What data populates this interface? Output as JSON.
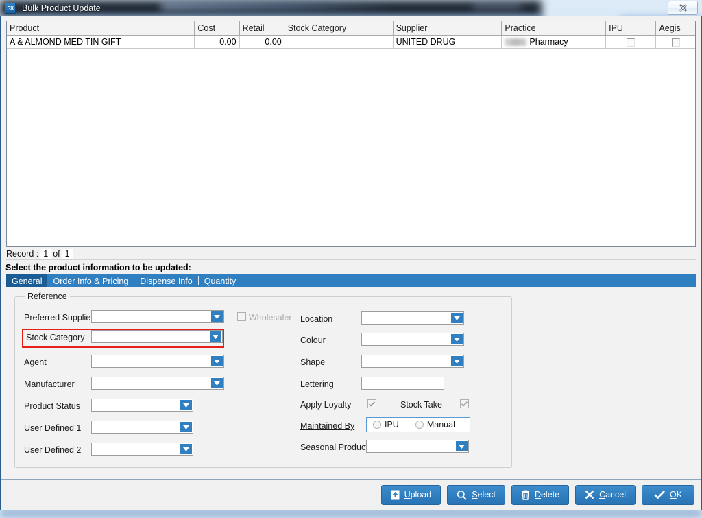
{
  "window": {
    "title": "Bulk Product Update",
    "app_icon": "rx-icon",
    "close_label": "close-icon"
  },
  "grid": {
    "columns": [
      {
        "key": "product",
        "label": "Product"
      },
      {
        "key": "cost",
        "label": "Cost"
      },
      {
        "key": "retail",
        "label": "Retail"
      },
      {
        "key": "stockcat",
        "label": "Stock Category"
      },
      {
        "key": "supplier",
        "label": "Supplier"
      },
      {
        "key": "practice",
        "label": "Practice"
      },
      {
        "key": "ipu",
        "label": "IPU"
      },
      {
        "key": "aegis",
        "label": "Aegis"
      }
    ],
    "rows": [
      {
        "product": "A & ALMOND MED TIN GIFT",
        "cost": "0.00",
        "retail": "0.00",
        "stockcat": "",
        "supplier": "UNITED DRUG",
        "practice": "Pharmacy",
        "practice_redacted": true,
        "ipu_checked": false,
        "aegis_checked": false
      }
    ]
  },
  "record_bar": {
    "label": "Record :",
    "current": "1",
    "of": "of",
    "total": "1"
  },
  "instruction": "Select the product information to be updated:",
  "tabs": [
    {
      "label": "General",
      "mnemonic": "G",
      "active": true
    },
    {
      "label": "Order Info & Pricing",
      "mnemonic": "P",
      "active": false
    },
    {
      "label": "Dispense Info",
      "mnemonic": "I",
      "active": false
    },
    {
      "label": "Quantity",
      "mnemonic": "Q",
      "active": false
    }
  ],
  "form": {
    "group_legend": "Reference",
    "preferred_supplier": {
      "label": "Preferred Supplier",
      "value": ""
    },
    "stock_category": {
      "label": "Stock Category",
      "value": "",
      "highlighted": true
    },
    "agent": {
      "label": "Agent",
      "value": ""
    },
    "manufacturer": {
      "label": "Manufacturer",
      "value": ""
    },
    "product_status": {
      "label": "Product Status",
      "value": ""
    },
    "user_defined_1": {
      "label": "User Defined 1",
      "value": ""
    },
    "user_defined_2": {
      "label": "User Defined 2",
      "value": ""
    },
    "wholesaler": {
      "label": "Wholesaler",
      "checked": false,
      "disabled": true
    },
    "location": {
      "label": "Location",
      "value": ""
    },
    "colour": {
      "label": "Colour",
      "value": ""
    },
    "shape": {
      "label": "Shape",
      "value": ""
    },
    "lettering": {
      "label": "Lettering",
      "value": ""
    },
    "apply_loyalty": {
      "label": "Apply Loyalty",
      "checked": true
    },
    "stock_take": {
      "label": "Stock Take",
      "checked": true
    },
    "maintained_by": {
      "label": "Maintained By",
      "options": [
        "IPU",
        "Manual"
      ],
      "option_ipu": "IPU",
      "option_manual": "Manual",
      "selected": ""
    },
    "seasonal_products": {
      "label": "Seasonal Products",
      "value": ""
    }
  },
  "footer": {
    "buttons": [
      {
        "label": "Upload",
        "mnemonic": "U",
        "icon": "upload-icon"
      },
      {
        "label": "Select",
        "mnemonic": "S",
        "icon": "magnifier-icon"
      },
      {
        "label": "Delete",
        "mnemonic": "D",
        "icon": "trash-icon"
      },
      {
        "label": "Cancel",
        "mnemonic": "C",
        "icon": "x-icon"
      },
      {
        "label": "OK",
        "mnemonic": "O",
        "icon": "check-icon"
      }
    ],
    "upload_label": "Upload",
    "select_label": "Select",
    "delete_label": "Delete",
    "cancel_label": "Cancel",
    "ok_label": "OK"
  },
  "colors": {
    "accent": "#2f7fc1",
    "tab_active": "#1a5c95",
    "highlight_box": "#e32119",
    "radio_box_border": "#5b9bd5"
  }
}
